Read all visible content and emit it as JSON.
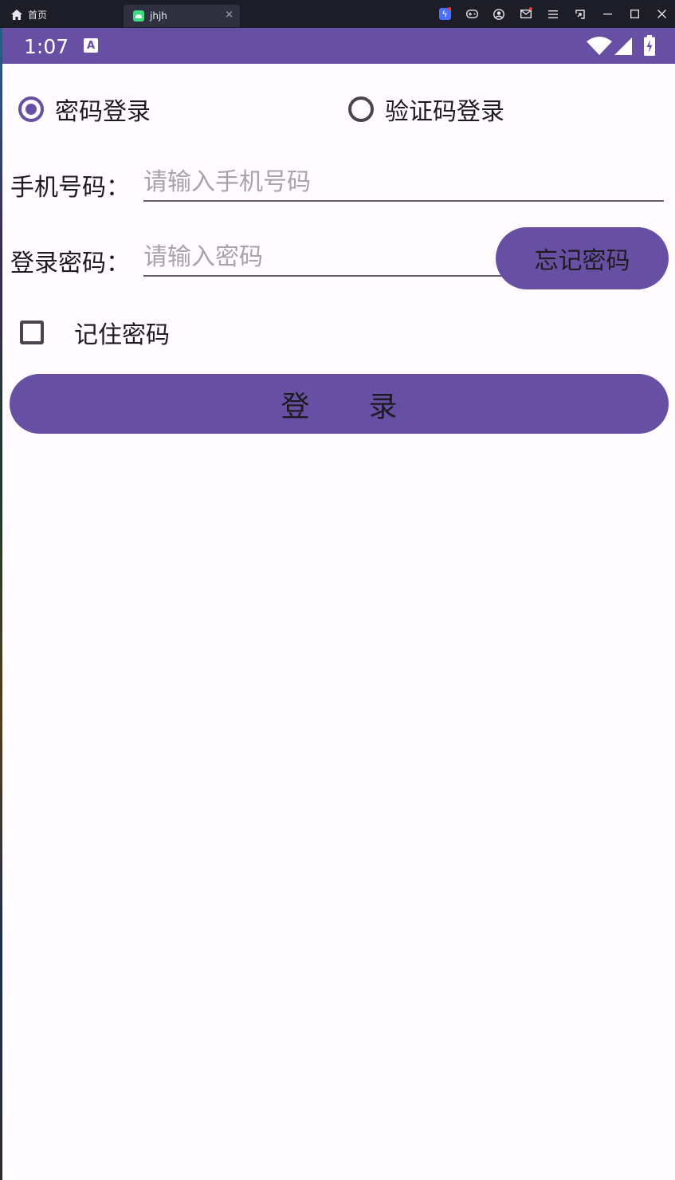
{
  "window": {
    "home_tab_label": "首页",
    "active_tab_label": "jhjh",
    "close_glyph": "×",
    "controls": [
      "boost-icon",
      "gamepad-icon",
      "account-icon",
      "mail-icon",
      "menu-icon",
      "screenshot-icon",
      "minimize-icon",
      "maximize-icon",
      "close-icon"
    ]
  },
  "statusbar": {
    "time": "1:07",
    "notification_glyph": "A"
  },
  "login_mode": {
    "options": [
      {
        "label": "密码登录",
        "selected": true
      },
      {
        "label": "验证码登录",
        "selected": false
      }
    ]
  },
  "phone": {
    "label": "手机号码：",
    "placeholder": "请输入手机号码",
    "value": ""
  },
  "password": {
    "label": "登录密码：",
    "placeholder": "请输入密码",
    "value": ""
  },
  "forgot_button": "忘记密码",
  "remember": {
    "label": "记住密码",
    "checked": false
  },
  "login_button": "登录",
  "colors": {
    "primary": "#6750a4",
    "background": "#fffbfe",
    "text": "#1c1b1f",
    "hint": "#a6a3ab"
  }
}
